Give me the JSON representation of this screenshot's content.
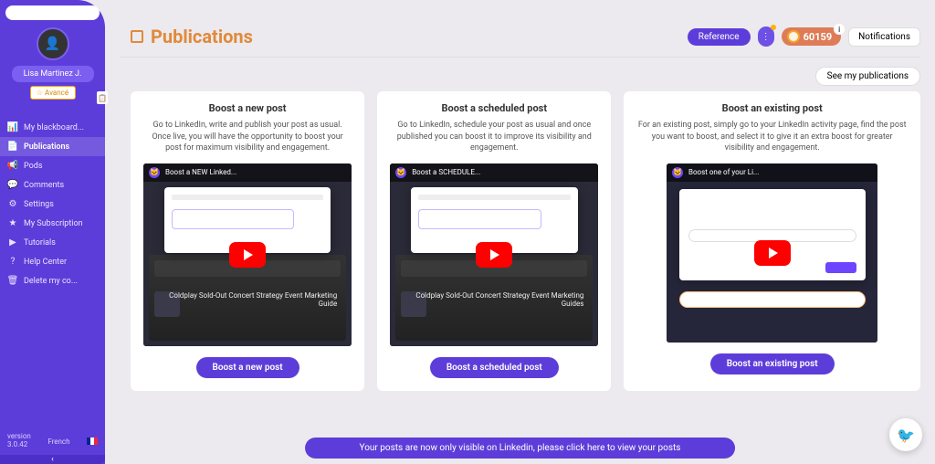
{
  "user": {
    "name": "Lisa Martinez J.",
    "level": "Avancé"
  },
  "sidebar": {
    "items": [
      {
        "icon": "📊",
        "label": "My blackboard..."
      },
      {
        "icon": "📄",
        "label": "Publications"
      },
      {
        "icon": "📢",
        "label": "Pods"
      },
      {
        "icon": "💬",
        "label": "Comments"
      },
      {
        "icon": "⚙",
        "label": "Settings"
      },
      {
        "icon": "★",
        "label": "My Subscription"
      },
      {
        "icon": "▶",
        "label": "Tutorials"
      },
      {
        "icon": "?",
        "label": "Help Center"
      },
      {
        "icon": "🗑",
        "label": "Delete my co..."
      }
    ],
    "version_label": "version",
    "version": "3.0.42",
    "language": "French"
  },
  "topbar": {
    "title": "Publications",
    "reference": "Reference",
    "coins": "60159",
    "notifications": "Notifications",
    "see_publications": "See my publications"
  },
  "cards": [
    {
      "title": "Boost a new post",
      "desc": "Go to LinkedIn, write and publish your post as usual. Once live, you will have the opportunity to boost your post for maximum visibility and engagement.",
      "video_title": "Boost a NEW Linked...",
      "feed_caption": "Coldplay\nSold-Out Concert Strategy\nEvent Marketing Guide",
      "button": "Boost a new post"
    },
    {
      "title": "Boost a scheduled post",
      "desc": "Go to LinkedIn, schedule your post as usual and once published you can boost it to improve its visibility and engagement.",
      "video_title": "Boost a SCHEDULE...",
      "feed_caption": "Coldplay\nSold-Out Concert Strategy\nEvent Marketing Guides",
      "button": "Boost a scheduled post"
    },
    {
      "title": "Boost an existing post",
      "desc": "For an existing post, simply go to your LinkedIn activity page, find the post you want to boost, and select it to give it an extra boost for greater visibility and engagement.",
      "video_title": "Boost one of your Li...",
      "button": "Boost an existing post"
    }
  ],
  "banner": "Your posts are now only visible on Linkedin, please click here to view your posts"
}
